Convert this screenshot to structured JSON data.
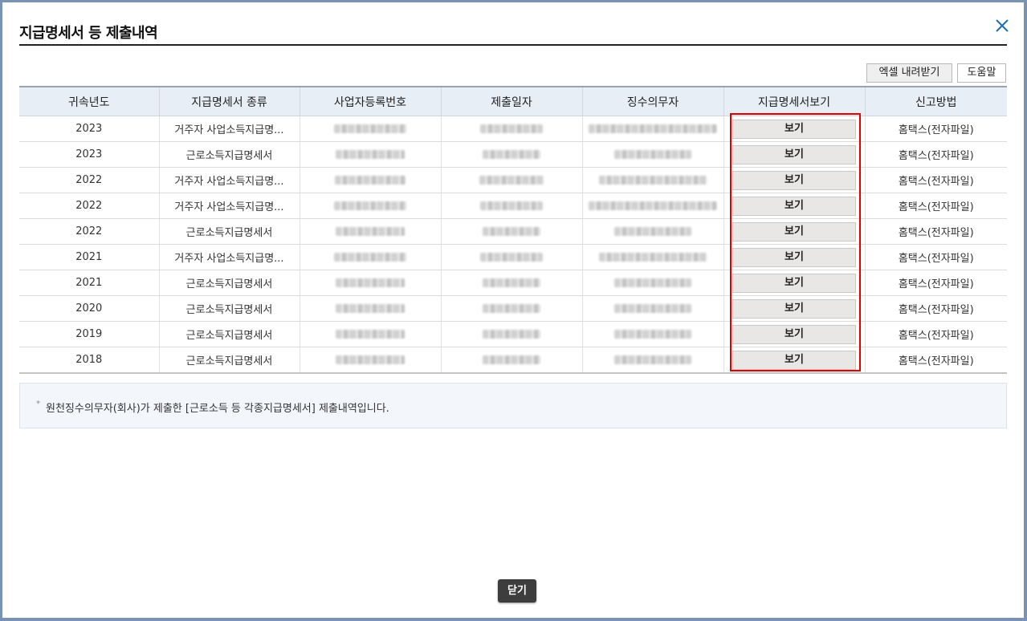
{
  "dialog": {
    "title": "지급명세서 등 제출내역",
    "close_icon": "close-icon",
    "accent_color": "#1f6fb8"
  },
  "toolbar": {
    "excel_label": "엑셀 내려받기",
    "help_label": "도움말"
  },
  "table": {
    "headers": [
      "귀속년도",
      "지급명세서 종류",
      "사업자등록번호",
      "제출일자",
      "징수의무자",
      "지급명세서보기",
      "신고방법"
    ],
    "rows": [
      {
        "year": "2023",
        "type": "거주자 사업소득지급명...",
        "view": "보기",
        "method": "홈택스(전자파일)"
      },
      {
        "year": "2023",
        "type": "근로소득지급명세서",
        "view": "보기",
        "method": "홈택스(전자파일)"
      },
      {
        "year": "2022",
        "type": "거주자 사업소득지급명...",
        "view": "보기",
        "method": "홈택스(전자파일)"
      },
      {
        "year": "2022",
        "type": "거주자 사업소득지급명...",
        "view": "보기",
        "method": "홈택스(전자파일)"
      },
      {
        "year": "2022",
        "type": "근로소득지급명세서",
        "view": "보기",
        "method": "홈택스(전자파일)"
      },
      {
        "year": "2021",
        "type": "거주자 사업소득지급명...",
        "view": "보기",
        "method": "홈택스(전자파일)"
      },
      {
        "year": "2021",
        "type": "근로소득지급명세서",
        "view": "보기",
        "method": "홈택스(전자파일)"
      },
      {
        "year": "2020",
        "type": "근로소득지급명세서",
        "view": "보기",
        "method": "홈택스(전자파일)"
      },
      {
        "year": "2019",
        "type": "근로소득지급명세서",
        "view": "보기",
        "method": "홈택스(전자파일)"
      },
      {
        "year": "2018",
        "type": "근로소득지급명세서",
        "view": "보기",
        "method": "홈택스(전자파일)"
      }
    ]
  },
  "notice": {
    "bullet": "*",
    "text": "원천징수의무자(회사)가 제출한 [근로소득 등 각종지급명세서] 제출내역입니다."
  },
  "footer": {
    "close_label": "닫기"
  }
}
